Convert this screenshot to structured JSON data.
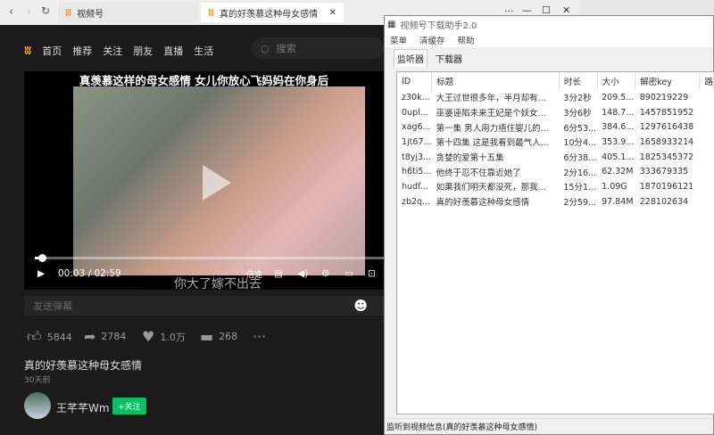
{
  "browser": {
    "tabs": [
      {
        "label": "视频号"
      },
      {
        "label": "真的好羡慕这种母女感情"
      }
    ]
  },
  "site": {
    "nav": [
      "首页",
      "推荐",
      "关注",
      "朋友",
      "直播",
      "生活"
    ],
    "search_placeholder": "搜索"
  },
  "video": {
    "title": "真羡慕这样的母女感情 女儿你放心飞妈妈在你身后",
    "time": "00:03 / 02:59",
    "speed_label": "倍速",
    "subtitle": "你大了嫁不出去",
    "progress": 0.02,
    "danmu_placeholder": "发送弹幕"
  },
  "stats": {
    "likes": "5844",
    "shares": "2784",
    "favorites": "1.0万",
    "comments": "268"
  },
  "post": {
    "title": "真的好羡慕这种母女感情",
    "date": "30天前",
    "author": "王芊芊Wm",
    "follow_label": "+关注"
  },
  "tool": {
    "title": "视频号下载助手2.0",
    "menu": [
      "菜单",
      "清缓存",
      "帮助"
    ],
    "tabs": [
      "监听器",
      "下载器"
    ],
    "columns": [
      "ID",
      "标题",
      "时长",
      "大小",
      "解密key",
      "路"
    ],
    "rows": [
      [
        "z30k...",
        "大王过世很多年，半月却有...",
        "3分2秒",
        "209.5...",
        "890219229"
      ],
      [
        "0upl...",
        "巫婆诬陷未来王妃是个妖女...",
        "3分6秒",
        "148.7...",
        "1457851952"
      ],
      [
        "xag6...",
        "第一集 男人用力捂住婴儿的...",
        "6分53...",
        "384.6...",
        "1297616438"
      ],
      [
        "1jt67...",
        "第十四集 这是我看到最气人...",
        "10分4...",
        "353.9...",
        "1658933214"
      ],
      [
        "t8yj3...",
        "贪婪的爱第十五集",
        "6分38...",
        "405.1...",
        "1825345372"
      ],
      [
        "h6ti5...",
        "他终于忍不住靠近她了",
        "2分16...",
        "62.32M",
        "333679335"
      ],
      [
        "hudf...",
        "如果我们明天都没死，那我...",
        "15分1...",
        "1.09G",
        "1870196121"
      ],
      [
        "zb2q...",
        "真的好羡慕这种母女感情",
        "2分59...",
        "97.84M",
        "228102634"
      ]
    ],
    "status": "监听到视频信息(真的好羡慕这种母女感情)"
  }
}
